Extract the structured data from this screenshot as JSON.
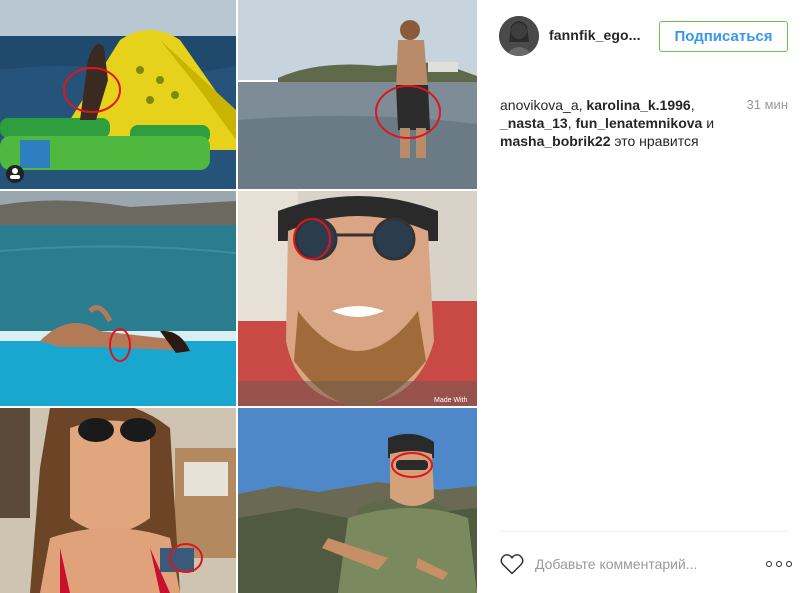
{
  "header": {
    "username": "fannfik_ego...",
    "follow_label": "Подписаться"
  },
  "likes": {
    "users": [
      "anovikova_a",
      "karolina_k.1996",
      "_nasta_13",
      "fun_lenatemnikova",
      "masha_bobrik22"
    ],
    "conj": "и",
    "suffix": "это нравится",
    "time": "31 мин"
  },
  "comment": {
    "placeholder": "Добавьте комментарий..."
  },
  "media": {
    "watermark": "Made With"
  },
  "colors": {
    "accent": "#3897f0",
    "follow_border": "#70c050",
    "circle_marker": "#e0141e"
  },
  "icons": {
    "like": "heart-outline-icon",
    "more": "more-options-icon",
    "user_tag": "user-tag-icon"
  }
}
